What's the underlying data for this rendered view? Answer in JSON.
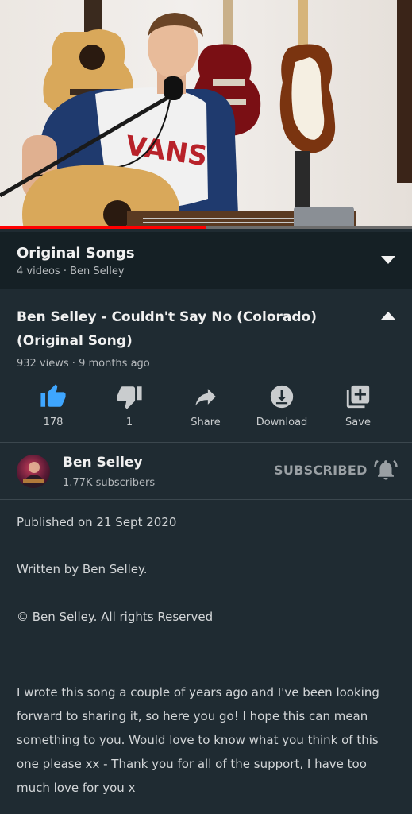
{
  "video": {
    "progress_fraction": 0.5,
    "colors": {
      "progress_played": "#ff0000",
      "progress_track": "#6d6d6d"
    }
  },
  "playlist": {
    "title": "Original Songs",
    "subtitle": "4 videos · Ben Selley",
    "toggle_icon": "chevron-down-icon"
  },
  "video_info": {
    "title": "Ben Selley - Couldn't Say No (Colorado) (Original Song)",
    "views": "932 views",
    "age": "9 months ago",
    "toggle_icon": "chevron-up-icon"
  },
  "actions": {
    "like": {
      "label": "178",
      "icon": "thumbs-up-icon",
      "active_color": "#3ea6ff"
    },
    "dislike": {
      "label": "1",
      "icon": "thumbs-down-icon"
    },
    "share": {
      "label": "Share",
      "icon": "share-icon"
    },
    "download": {
      "label": "Download",
      "icon": "download-icon"
    },
    "save": {
      "label": "Save",
      "icon": "playlist-add-icon"
    }
  },
  "channel": {
    "name": "Ben Selley",
    "subscribers": "1.77K subscribers",
    "subscribe_label": "SUBSCRIBED",
    "bell_icon": "notification-bell-icon"
  },
  "description": {
    "published": "Published on 21 Sept 2020",
    "written_by": "Written by Ben Selley.",
    "copyright": "© Ben Selley. All rights Reserved",
    "body": "I wrote this song a couple of years ago and I've been looking forward to sharing it, so here you go! I hope this can mean something to you. Would love to know what you think of this one please xx - Thank you for all of the support, I have too much love for you x"
  },
  "theme": {
    "background": "#1f2b32",
    "header_background": "#152025"
  }
}
